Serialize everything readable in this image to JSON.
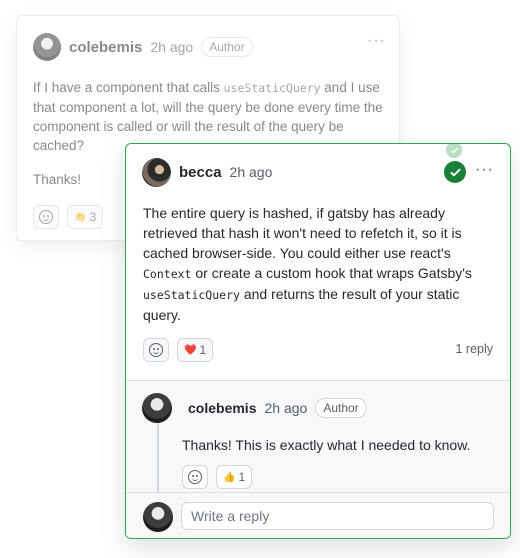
{
  "original_comment": {
    "author": "colebemis",
    "time": "2h ago",
    "badge": "Author",
    "more_icon": "kebab-horizontal-icon",
    "body_parts": [
      "If I have a component that calls ",
      "useStaticQuery",
      " and I use that component a lot, will the query be done every time the component is called or will the result of the query be cached?"
    ],
    "thanks": "Thanks!",
    "reaction_emoji": "👏",
    "reaction_count": "3"
  },
  "answer": {
    "author": "becca",
    "time": "2h ago",
    "accepted_color": "#1a7f37",
    "more_icon": "kebab-horizontal-icon",
    "body_parts": [
      "The entire query is hashed, if gatsby has already retrieved that hash it won't need to refetch it, so it is cached browser-side. You could either use react's ",
      "Context",
      " or create a custom hook that wraps Gatsby's ",
      "useStaticQuery",
      " and returns the result of your static query."
    ],
    "reaction_emoji": "❤️",
    "reaction_count": "1",
    "reply_count": "1 reply"
  },
  "reply": {
    "author": "colebemis",
    "time": "2h ago",
    "badge": "Author",
    "text": "Thanks! This is exactly what I needed to know.",
    "reaction_emoji": "👍",
    "reaction_count": "1"
  },
  "composer": {
    "placeholder": "Write a reply"
  }
}
